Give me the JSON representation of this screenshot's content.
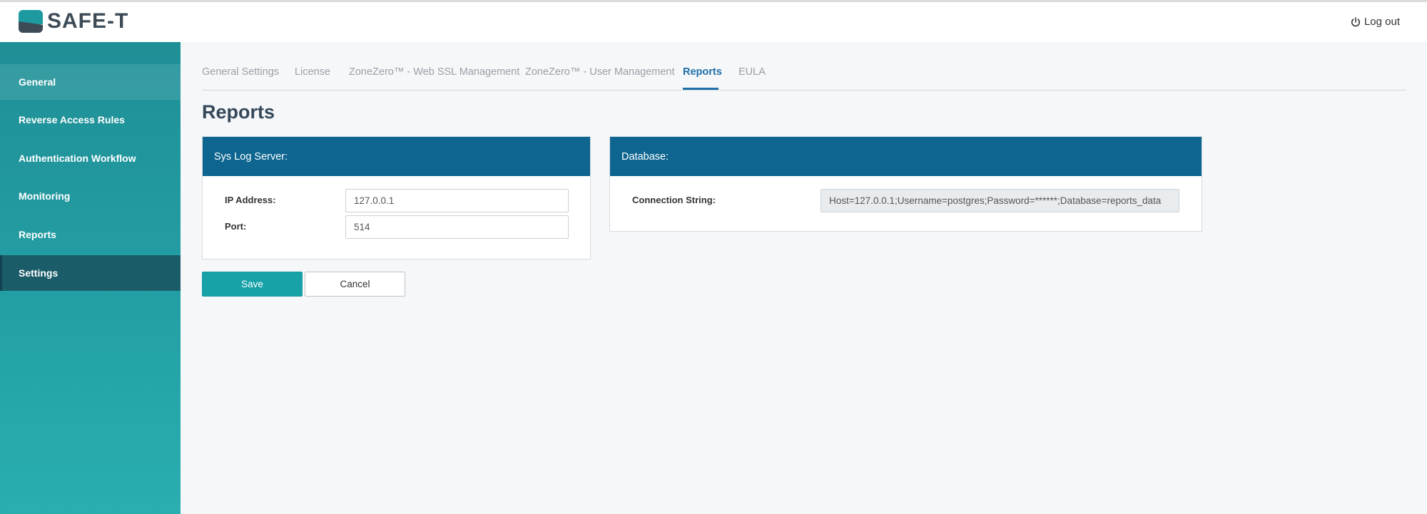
{
  "app": {
    "logo_text": "SAFE-T",
    "logout_label": "Log out"
  },
  "sidebar": {
    "items": [
      {
        "label": "General"
      },
      {
        "label": "Reverse Access Rules"
      },
      {
        "label": "Authentication Workflow"
      },
      {
        "label": "Monitoring"
      },
      {
        "label": "Reports"
      },
      {
        "label": "Settings"
      }
    ],
    "active": "Settings"
  },
  "tabs": {
    "items": [
      {
        "label": "General Settings"
      },
      {
        "label": "License"
      },
      {
        "label": "ZoneZero™ - Web SSL Management"
      },
      {
        "label": "ZoneZero™ - User Management"
      },
      {
        "label": "Reports"
      },
      {
        "label": "EULA"
      }
    ],
    "active": "Reports"
  },
  "page": {
    "title": "Reports"
  },
  "syslog": {
    "header": "Sys Log Server:",
    "ip_label": "IP Address:",
    "ip_value": "127.0.0.1",
    "port_label": "Port:",
    "port_value": "514"
  },
  "database": {
    "header": "Database:",
    "conn_label": "Connection String:",
    "conn_value": "Host=127.0.0.1;Username=postgres;Password=******;Database=reports_data"
  },
  "actions": {
    "save_label": "Save",
    "cancel_label": "Cancel"
  },
  "colors": {
    "sidebar": "#23a1a6",
    "sidebar_active": "#1a5d68",
    "panel_header": "#0e6690",
    "accent": "#1f6fa8",
    "save_button": "#17a2a8"
  },
  "icons": {
    "logout": "power-icon",
    "logo": "safe-t-logo-icon"
  }
}
